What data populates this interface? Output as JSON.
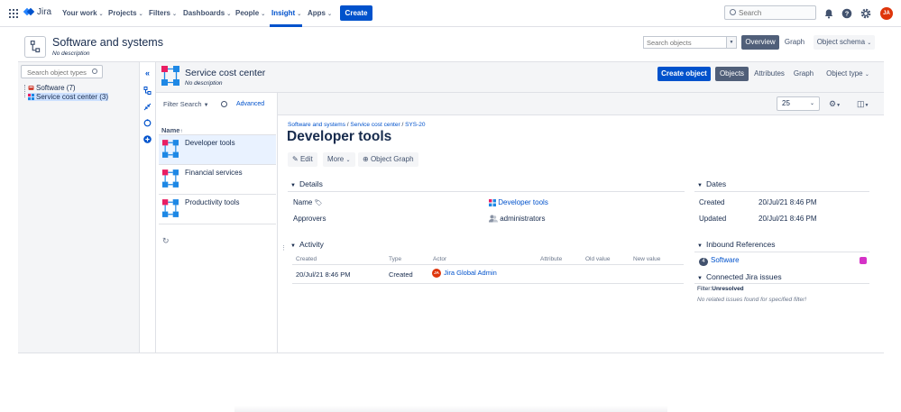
{
  "topnav": {
    "brand": "Jira",
    "items": [
      {
        "label": "Your work",
        "chev": "⌄"
      },
      {
        "label": "Projects",
        "chev": "⌄"
      },
      {
        "label": "Filters",
        "chev": "⌄"
      },
      {
        "label": "Dashboards",
        "chev": "⌄"
      },
      {
        "label": "People",
        "chev": "⌄"
      },
      {
        "label": "Insight",
        "chev": "⌄"
      },
      {
        "label": "Apps",
        "chev": "⌄"
      }
    ],
    "create_label": "Create",
    "search_placeholder": "Search",
    "avatar_initials": "JA",
    "accent": "#0052cc",
    "icons": [
      "app-switcher-icon",
      "notifications-icon",
      "help-icon",
      "settings-icon"
    ]
  },
  "schema": {
    "title": "Software and systems",
    "description": "No description",
    "search_placeholder": "Search objects",
    "tabs": {
      "overview": "Overview",
      "graph": "Graph",
      "object_schema": "Object schema"
    }
  },
  "tree": {
    "search_placeholder": "Search object types",
    "nodes": [
      {
        "label": "Software (7)"
      },
      {
        "label": "Service cost center (3)"
      }
    ]
  },
  "object_type": {
    "title": "Service cost center",
    "description": "No description",
    "create_object": "Create object",
    "tabs": {
      "objects": "Objects",
      "attributes": "Attributes",
      "graph": "Graph",
      "object_type": "Object type"
    }
  },
  "filterbar": {
    "filter_search": "Filter Search",
    "advanced": "Advanced",
    "page_size": "25"
  },
  "list": {
    "column": "Name",
    "rows": [
      {
        "label": "Developer tools"
      },
      {
        "label": "Financial services"
      },
      {
        "label": "Productivity tools"
      }
    ]
  },
  "detail": {
    "breadcrumb": [
      "Software and systems",
      "Service cost center",
      "SYS-20"
    ],
    "title": "Developer tools",
    "actions": {
      "edit": "Edit",
      "more": "More",
      "object_graph": "Object Graph"
    },
    "details_title": "Details",
    "fields": [
      {
        "name": "Name",
        "value": "Developer tools"
      },
      {
        "name": "Approvers",
        "value": "administrators"
      }
    ],
    "activity_title": "Activity",
    "activity_columns": [
      "Created",
      "Type",
      "Actor",
      "Attribute",
      "Old value",
      "New value"
    ],
    "activity_rows": [
      {
        "created": "20/Jul/21 8:46 PM",
        "type": "Created",
        "actor": "Jira Global Admin",
        "actor_initials": "JA"
      }
    ]
  },
  "sidebar_right": {
    "dates_title": "Dates",
    "dates": [
      {
        "label": "Created",
        "value": "20/Jul/21 8:46 PM"
      },
      {
        "label": "Updated",
        "value": "20/Jul/21 8:46 PM"
      }
    ],
    "inbound_title": "Inbound References",
    "inbound": [
      {
        "count": "4",
        "label": "Software"
      }
    ],
    "issues_title": "Connected Jira issues",
    "filter_label": "Filter:",
    "filter_value": "Unresolved",
    "no_issues": "No related issues found for specified filter!"
  }
}
